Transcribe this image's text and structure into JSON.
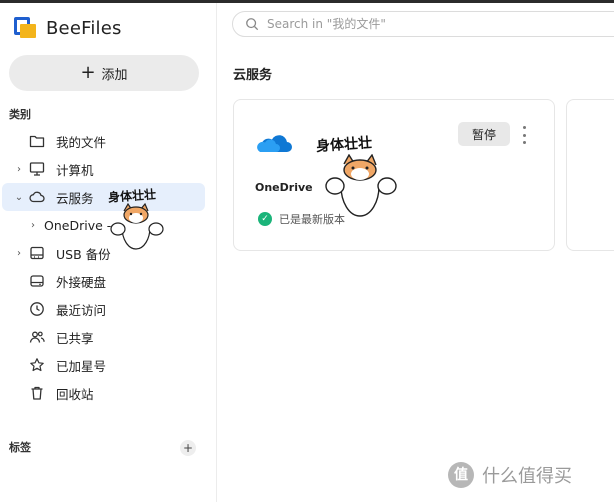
{
  "app": {
    "name": "BeeFiles"
  },
  "sidebar": {
    "add_label": "添加",
    "section_categories": "类别",
    "items": [
      {
        "label": "我的文件",
        "icon": "folder-icon",
        "expandable": false
      },
      {
        "label": "计算机",
        "icon": "monitor-icon",
        "expandable": true
      },
      {
        "label": "云服务",
        "icon": "cloud-icon",
        "expandable": true,
        "expanded": true,
        "active": true
      },
      {
        "label": "OneDrive - ",
        "icon": "",
        "expandable": true,
        "child": true
      },
      {
        "label": "USB 备份",
        "icon": "usb-drive-icon",
        "expandable": true
      },
      {
        "label": "外接硬盘",
        "icon": "hard-drive-icon",
        "expandable": false
      },
      {
        "label": "最近访问",
        "icon": "clock-icon",
        "expandable": false
      },
      {
        "label": "已共享",
        "icon": "users-icon",
        "expandable": false
      },
      {
        "label": "已加星号",
        "icon": "star-icon",
        "expandable": false
      },
      {
        "label": "回收站",
        "icon": "trash-icon",
        "expandable": false
      }
    ],
    "section_tags": "标签"
  },
  "search": {
    "placeholder": "Search in \"我的文件\""
  },
  "main": {
    "title": "云服务",
    "card": {
      "name": "OneDrive",
      "pause_label": "暂停",
      "status": "已是最新版本",
      "logo": "onedrive-logo-icon"
    }
  },
  "stickers": {
    "text": "身体壮壮"
  },
  "watermark": {
    "text": "什么值得买",
    "badge": "值"
  },
  "colors": {
    "accent": "#1f5fcf",
    "active_bg": "#e6effc",
    "success": "#1bb47a",
    "logo_yellow": "#f3b41b"
  }
}
